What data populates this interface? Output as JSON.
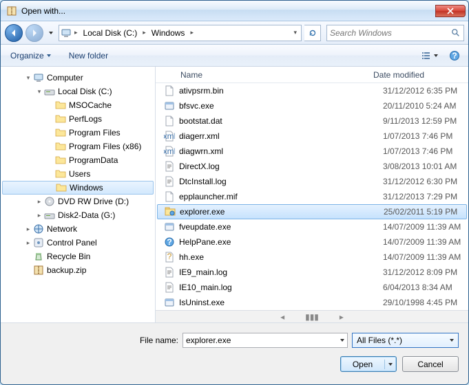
{
  "title": "Open with...",
  "breadcrumb": {
    "segments": [
      "Local Disk (C:)",
      "Windows"
    ]
  },
  "search": {
    "placeholder": "Search Windows"
  },
  "toolbar": {
    "organize": "Organize",
    "new_folder": "New folder"
  },
  "tree": [
    {
      "depth": 2,
      "label": "Computer",
      "icon": "computer",
      "toggle": "▾"
    },
    {
      "depth": 3,
      "label": "Local Disk (C:)",
      "icon": "drive",
      "toggle": "▾"
    },
    {
      "depth": 4,
      "label": "MSOCache",
      "icon": "folder"
    },
    {
      "depth": 4,
      "label": "PerfLogs",
      "icon": "folder"
    },
    {
      "depth": 4,
      "label": "Program Files",
      "icon": "folder"
    },
    {
      "depth": 4,
      "label": "Program Files (x86)",
      "icon": "folder"
    },
    {
      "depth": 4,
      "label": "ProgramData",
      "icon": "folder"
    },
    {
      "depth": 4,
      "label": "Users",
      "icon": "folder"
    },
    {
      "depth": 4,
      "label": "Windows",
      "icon": "folder",
      "selected": true
    },
    {
      "depth": 3,
      "label": "DVD RW Drive (D:)",
      "icon": "dvd",
      "toggle": "▸"
    },
    {
      "depth": 3,
      "label": "Disk2-Data (G:)",
      "icon": "drive",
      "toggle": "▸"
    },
    {
      "depth": 2,
      "label": "Network",
      "icon": "network",
      "toggle": "▸"
    },
    {
      "depth": 2,
      "label": "Control Panel",
      "icon": "cpl",
      "toggle": "▸"
    },
    {
      "depth": 2,
      "label": "Recycle Bin",
      "icon": "recycle"
    },
    {
      "depth": 2,
      "label": "backup.zip",
      "icon": "zip"
    }
  ],
  "columns": {
    "name": "Name",
    "date": "Date modified"
  },
  "files": [
    {
      "name": "ativpsrm.bin",
      "date": "31/12/2012 6:35 PM",
      "icon": "file"
    },
    {
      "name": "bfsvc.exe",
      "date": "20/11/2010 5:24 AM",
      "icon": "exe"
    },
    {
      "name": "bootstat.dat",
      "date": "9/11/2013 12:59 PM",
      "icon": "file"
    },
    {
      "name": "diagerr.xml",
      "date": "1/07/2013 7:46 PM",
      "icon": "xml"
    },
    {
      "name": "diagwrn.xml",
      "date": "1/07/2013 7:46 PM",
      "icon": "xml"
    },
    {
      "name": "DirectX.log",
      "date": "3/08/2013 10:01 AM",
      "icon": "txt"
    },
    {
      "name": "DtcInstall.log",
      "date": "31/12/2012 6:30 PM",
      "icon": "txt"
    },
    {
      "name": "epplauncher.mif",
      "date": "31/12/2013 7:29 PM",
      "icon": "file"
    },
    {
      "name": "explorer.exe",
      "date": "25/02/2011 5:19 PM",
      "icon": "explorer",
      "selected": true
    },
    {
      "name": "fveupdate.exe",
      "date": "14/07/2009 11:39 AM",
      "icon": "exe"
    },
    {
      "name": "HelpPane.exe",
      "date": "14/07/2009 11:39 AM",
      "icon": "help"
    },
    {
      "name": "hh.exe",
      "date": "14/07/2009 11:39 AM",
      "icon": "hh"
    },
    {
      "name": "IE9_main.log",
      "date": "31/12/2012 8:09 PM",
      "icon": "txt"
    },
    {
      "name": "IE10_main.log",
      "date": "6/04/2013 8:34 AM",
      "icon": "txt"
    },
    {
      "name": "IsUninst.exe",
      "date": "29/10/1998 4:45 PM",
      "icon": "exe"
    }
  ],
  "footer": {
    "filename_label": "File name:",
    "filename_value": "explorer.exe",
    "filter": "All Files (*.*)",
    "open": "Open",
    "cancel": "Cancel"
  }
}
